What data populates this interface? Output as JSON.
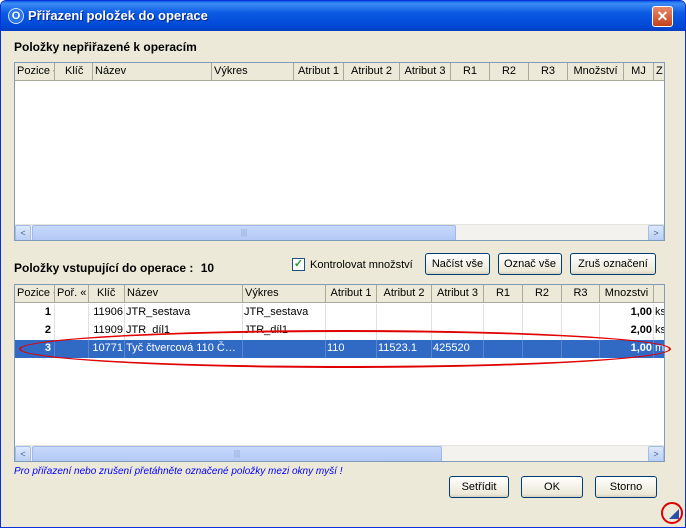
{
  "window": {
    "title": "Přiřazení položek do operace",
    "close_glyph": "✕",
    "app_icon_glyph": "O"
  },
  "top_panel": {
    "label": "Položky nepřiřazené k operacím",
    "columns": [
      "Pozice «",
      "Klíč",
      "Název",
      "Výkres",
      "Atribut 1",
      "Atribut 2",
      "Atribut 3",
      "R1",
      "R2",
      "R3",
      "Množství",
      "MJ",
      "Z"
    ],
    "scroll_left": "<",
    "scroll_right": ">",
    "thumb_grip": "|||"
  },
  "bottom_panel": {
    "label": "Položky vstupující do operace :",
    "count": "10",
    "check_quantity": {
      "label": "Kontrolovat množství",
      "checked": true,
      "glyph": "✓"
    },
    "load_all": "Načíst vše",
    "select_all": "Označ vše",
    "clear_selection": "Zruš označení",
    "columns": [
      "Pozice «",
      "Poř. «",
      "Klíč",
      "Název",
      "Výkres",
      "Atribut 1",
      "Atribut 2",
      "Atribut 3",
      "R1",
      "R2",
      "R3",
      "Mnozstvi",
      ""
    ],
    "rows": [
      {
        "pozice": "1",
        "por": "",
        "klic": "11906",
        "nazev": "JTR_sestava",
        "vykres": "JTR_sestava",
        "atr1": "",
        "atr2": "",
        "atr3": "",
        "r1": "",
        "r2": "",
        "r3": "",
        "mnozstvi": "1,00",
        "mj": "ks",
        "selected": false
      },
      {
        "pozice": "2",
        "por": "",
        "klic": "11909",
        "nazev": "JTR_díl1",
        "vykres": "JTR_díl1",
        "atr1": "",
        "atr2": "",
        "atr3": "",
        "r1": "",
        "r2": "",
        "r3": "",
        "mnozstvi": "2,00",
        "mj": "ks",
        "selected": false
      },
      {
        "pozice": "3",
        "por": "",
        "klic": "10771",
        "nazev": "Tyč čtvercová 110 Č…",
        "vykres": "",
        "atr1": "110",
        "atr2": "11523.1",
        "atr3": "425520",
        "r1": "",
        "r2": "",
        "r3": "",
        "mnozstvi": "1,00",
        "mj": "m",
        "selected": true
      }
    ],
    "scroll_left": "<",
    "scroll_right": ">",
    "thumb_grip": "|||"
  },
  "hint": "Pro přiřazení nebo zrušení přetáhněte označené položky mezi okny myší !",
  "buttons": {
    "sort": "Setřídit",
    "ok": "OK",
    "cancel": "Storno"
  },
  "colors": {
    "selection": "#316ac5",
    "annotation": "#e00000",
    "title_bar": "#0054e3",
    "hint_text": "#0000ff"
  }
}
